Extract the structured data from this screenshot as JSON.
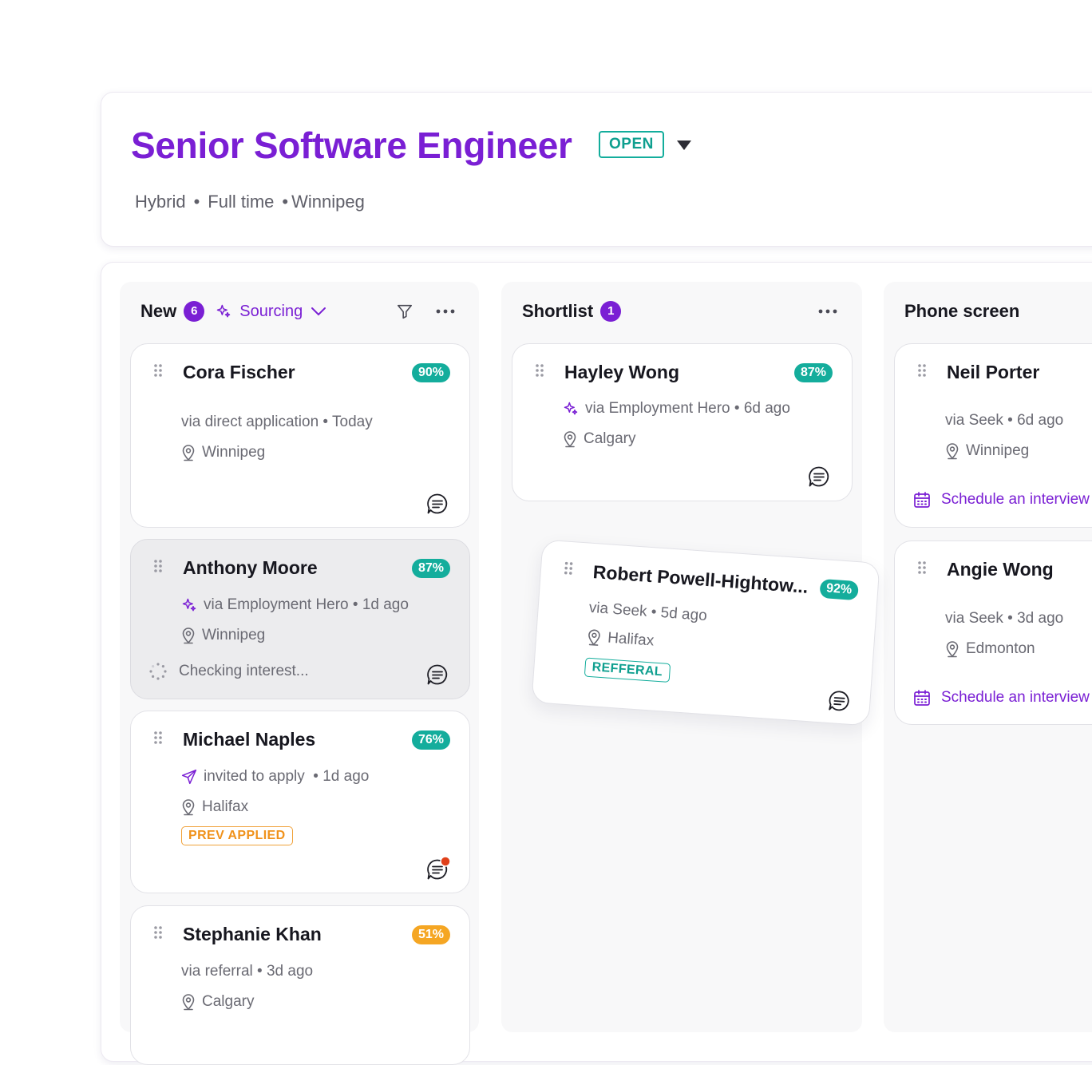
{
  "job": {
    "title": "Senior Software Engineer",
    "status": "OPEN",
    "work_mode": "Hybrid",
    "employment_type": "Full time",
    "location": "Winnipeg"
  },
  "columns": {
    "new": {
      "title": "New",
      "count": "6",
      "sourcing_label": "Sourcing"
    },
    "shortlist": {
      "title": "Shortlist",
      "count": "1"
    },
    "phone_screen": {
      "title": "Phone screen"
    }
  },
  "cards": {
    "cora": {
      "name": "Cora Fischer",
      "score": "90%",
      "source": "via direct application • Today",
      "location": "Winnipeg"
    },
    "anthony": {
      "name": "Anthony Moore",
      "score": "87%",
      "source": "via Employment Hero • 1d ago",
      "location": "Winnipeg",
      "status": "Checking interest..."
    },
    "michael": {
      "name": "Michael Naples",
      "score": "76%",
      "source": "invited to apply  • 1d ago",
      "location": "Halifax",
      "tag": "PREV APPLIED"
    },
    "stephanie": {
      "name": "Stephanie Khan",
      "score": "51%",
      "source": "via referral • 3d ago",
      "location": "Calgary"
    },
    "hayley": {
      "name": "Hayley Wong",
      "score": "87%",
      "source": "via Employment Hero • 6d ago",
      "location": "Calgary"
    },
    "robert": {
      "name": "Robert Powell-Hightow...",
      "score": "92%",
      "source": "via Seek • 5d ago",
      "location": "Halifax",
      "tag": "REFFERAL"
    },
    "neil": {
      "name": "Neil Porter",
      "source": "via Seek • 6d ago",
      "location": "Winnipeg",
      "action": "Schedule an interview"
    },
    "angie": {
      "name": "Angie Wong",
      "source": "via Seek • 3d ago",
      "location": "Edmonton",
      "action": "Schedule an interview"
    }
  },
  "colors": {
    "brand": "#7a1fd4",
    "score_green": "#14ad9c",
    "score_orange": "#f5a623",
    "prev_applied": "#f0921b",
    "unread_dot": "#e0401a"
  }
}
